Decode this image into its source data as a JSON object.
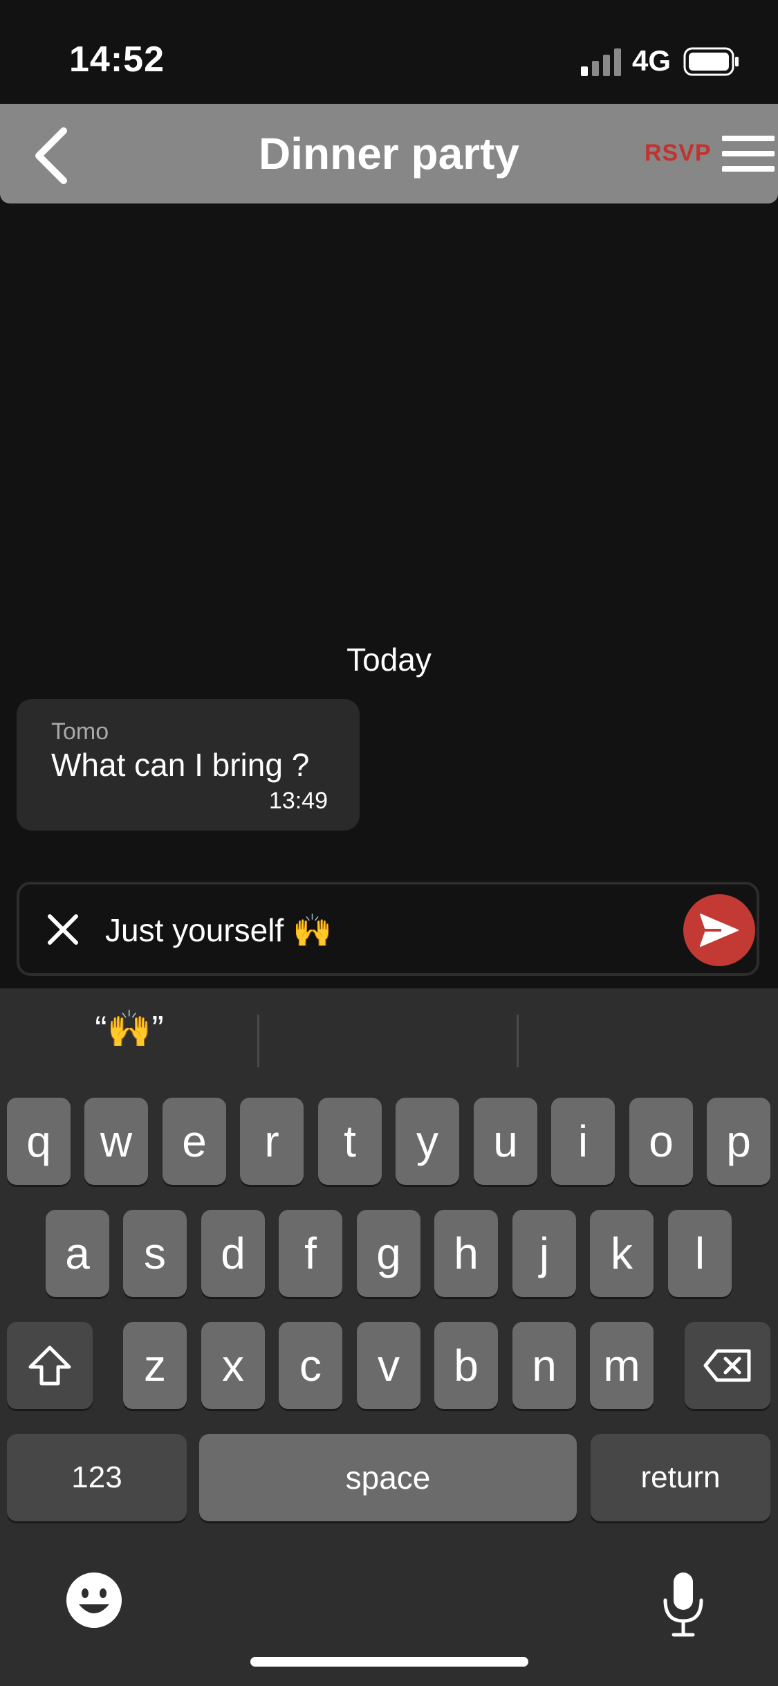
{
  "status_bar": {
    "time": "14:52",
    "network": "4G",
    "icons": [
      "signal-icon",
      "battery-icon"
    ]
  },
  "header": {
    "title": "Dinner party",
    "rsvp_label": "RSVP",
    "icons": [
      "back-chevron-icon",
      "hamburger-menu-icon"
    ]
  },
  "chat": {
    "date_divider": "Today",
    "messages": [
      {
        "sender": "Tomo",
        "text": "What can I bring ?",
        "time": "13:49"
      }
    ]
  },
  "composer": {
    "value": "Just yourself 🙌",
    "icons": [
      "clear-x-icon",
      "send-arrow-icon"
    ]
  },
  "keyboard": {
    "predictions": [
      "“🙌”",
      "",
      ""
    ],
    "rows": [
      [
        "q",
        "w",
        "e",
        "r",
        "t",
        "y",
        "u",
        "i",
        "o",
        "p"
      ],
      [
        "a",
        "s",
        "d",
        "f",
        "g",
        "h",
        "j",
        "k",
        "l"
      ],
      [
        "z",
        "x",
        "c",
        "v",
        "b",
        "n",
        "m"
      ]
    ],
    "numbers_label": "123",
    "space_label": "space",
    "return_label": "return",
    "icons": [
      "shift-icon",
      "backspace-icon",
      "emoji-icon",
      "microphone-icon"
    ]
  },
  "colors": {
    "accent_red": "#c33a34",
    "rsvp_red": "#c0332f",
    "header_gray": "#878787",
    "background": "#121212"
  }
}
